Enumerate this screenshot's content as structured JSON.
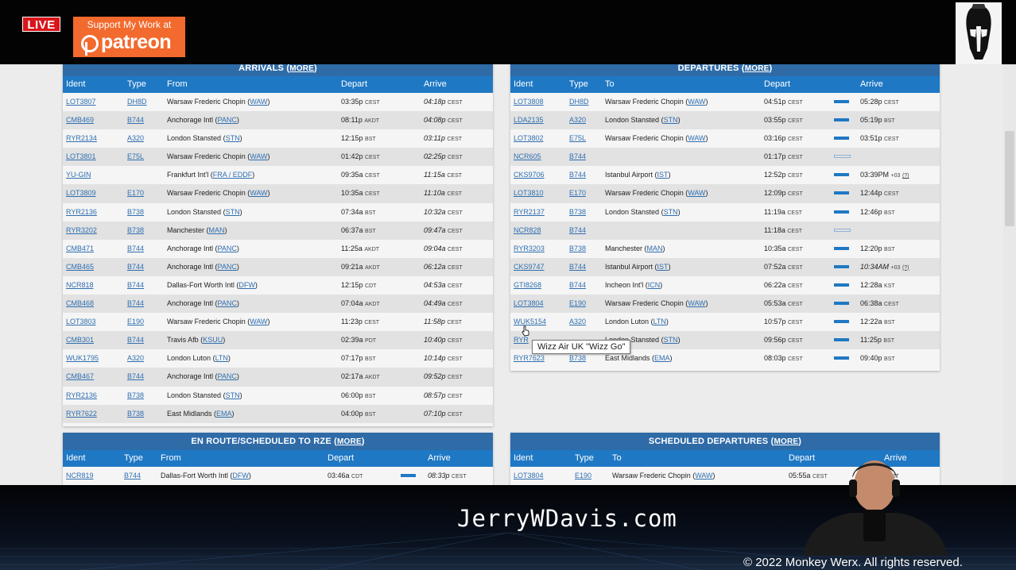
{
  "overlay": {
    "live_label": "LIVE",
    "patreon_support": "Support My Work at",
    "patreon_brand": "patreon",
    "website": "JerryWDavis.com",
    "copyright": "© 2022 Monkey Werx. All rights reserved."
  },
  "tooltip": "Wizz Air UK \"Wizz Go\"",
  "arrivals": {
    "title": "ARRIVALS",
    "more": "MORE",
    "headers": [
      "Ident",
      "Type",
      "From",
      "Depart",
      "Arrive"
    ],
    "rows": [
      {
        "ident": "LOT3807",
        "type": "DH8D",
        "from": "Warsaw Frederic Chopin",
        "code": "WAW",
        "depart": "03:35p",
        "dtz": "CEST",
        "arrive": "04:18p",
        "atz": "CEST"
      },
      {
        "ident": "CMB469",
        "type": "B744",
        "from": "Anchorage Intl",
        "code": "PANC",
        "depart": "08:11p",
        "dtz": "AKDT",
        "arrive": "04:08p",
        "atz": "CEST"
      },
      {
        "ident": "RYR2134",
        "type": "A320",
        "from": "London Stansted",
        "code": "STN",
        "depart": "12:15p",
        "dtz": "BST",
        "arrive": "03:11p",
        "atz": "CEST"
      },
      {
        "ident": "LOT3801",
        "type": "E75L",
        "from": "Warsaw Frederic Chopin",
        "code": "WAW",
        "depart": "01:42p",
        "dtz": "CEST",
        "arrive": "02:25p",
        "atz": "CEST"
      },
      {
        "ident": "YU-GIN",
        "type": "",
        "from": "Frankfurt Int'l",
        "code": "FRA / EDDF",
        "depart": "09:35a",
        "dtz": "CEST",
        "arrive": "11:15a",
        "atz": "CEST"
      },
      {
        "ident": "LOT3809",
        "type": "E170",
        "from": "Warsaw Frederic Chopin",
        "code": "WAW",
        "depart": "10:35a",
        "dtz": "CEST",
        "arrive": "11:10a",
        "atz": "CEST"
      },
      {
        "ident": "RYR2136",
        "type": "B738",
        "from": "London Stansted",
        "code": "STN",
        "depart": "07:34a",
        "dtz": "BST",
        "arrive": "10:32a",
        "atz": "CEST"
      },
      {
        "ident": "RYR3202",
        "type": "B738",
        "from": "Manchester",
        "code": "MAN",
        "depart": "06:37a",
        "dtz": "BST",
        "arrive": "09:47a",
        "atz": "CEST"
      },
      {
        "ident": "CMB471",
        "type": "B744",
        "from": "Anchorage Intl",
        "code": "PANC",
        "depart": "11:25a",
        "dtz": "AKDT",
        "arrive": "09:04a",
        "atz": "CEST"
      },
      {
        "ident": "CMB465",
        "type": "B744",
        "from": "Anchorage Intl",
        "code": "PANC",
        "depart": "09:21a",
        "dtz": "AKDT",
        "arrive": "06:12a",
        "atz": "CEST"
      },
      {
        "ident": "NCR818",
        "type": "B744",
        "from": "Dallas-Fort Worth Intl",
        "code": "DFW",
        "depart": "12:15p",
        "dtz": "CDT",
        "arrive": "04:53a",
        "atz": "CEST"
      },
      {
        "ident": "CMB468",
        "type": "B744",
        "from": "Anchorage Intl",
        "code": "PANC",
        "depart": "07:04a",
        "dtz": "AKDT",
        "arrive": "04:49a",
        "atz": "CEST"
      },
      {
        "ident": "LOT3803",
        "type": "E190",
        "from": "Warsaw Frederic Chopin",
        "code": "WAW",
        "depart": "11:23p",
        "dtz": "CEST",
        "arrive": "11:58p",
        "atz": "CEST"
      },
      {
        "ident": "CMB301",
        "type": "B744",
        "from": "Travis Afb",
        "code": "KSUU",
        "depart": "02:39a",
        "dtz": "PDT",
        "arrive": "10:40p",
        "atz": "CEST"
      },
      {
        "ident": "WUK1795",
        "type": "A320",
        "from": "London Luton",
        "code": "LTN",
        "depart": "07:17p",
        "dtz": "BST",
        "arrive": "10:14p",
        "atz": "CEST"
      },
      {
        "ident": "CMB467",
        "type": "B744",
        "from": "Anchorage Intl",
        "code": "PANC",
        "depart": "02:17a",
        "dtz": "AKDT",
        "arrive": "09:52p",
        "atz": "CEST"
      },
      {
        "ident": "RYR2136",
        "type": "B738",
        "from": "London Stansted",
        "code": "STN",
        "depart": "06:00p",
        "dtz": "BST",
        "arrive": "08:57p",
        "atz": "CEST"
      },
      {
        "ident": "RYR7622",
        "type": "B738",
        "from": "East Midlands",
        "code": "EMA",
        "depart": "04:00p",
        "dtz": "BST",
        "arrive": "07:10p",
        "atz": "CEST"
      }
    ]
  },
  "departures": {
    "title": "DEPARTURES",
    "more": "MORE",
    "headers": [
      "Ident",
      "Type",
      "To",
      "Depart",
      "Arrive"
    ],
    "rows": [
      {
        "ident": "LOT3808",
        "type": "DH8D",
        "to": "Warsaw Frederic Chopin",
        "code": "WAW",
        "depart": "04:51p",
        "dtz": "CEST",
        "progress": 1,
        "arrive": "05:28p",
        "atz": "CEST",
        "arr_italic": false,
        "extra": ""
      },
      {
        "ident": "LDA2135",
        "type": "A320",
        "to": "London Stansted",
        "code": "STN",
        "depart": "03:55p",
        "dtz": "CEST",
        "progress": 1,
        "arrive": "05:19p",
        "atz": "BST",
        "arr_italic": false,
        "extra": ""
      },
      {
        "ident": "LOT3802",
        "type": "E75L",
        "to": "Warsaw Frederic Chopin",
        "code": "WAW",
        "depart": "03:16p",
        "dtz": "CEST",
        "progress": 1,
        "arrive": "03:51p",
        "atz": "CEST",
        "arr_italic": false,
        "extra": ""
      },
      {
        "ident": "NCR605",
        "type": "B744",
        "to": "",
        "code": "",
        "depart": "01:17p",
        "dtz": "CEST",
        "progress": 0,
        "arrive": "",
        "atz": "",
        "arr_italic": false,
        "extra": ""
      },
      {
        "ident": "CKS9706",
        "type": "B744",
        "to": "Istanbul Airport",
        "code": "IST",
        "depart": "12:52p",
        "dtz": "CEST",
        "progress": 1,
        "arrive": "03:39PM",
        "atz": "+03",
        "arr_italic": false,
        "extra": "(?)"
      },
      {
        "ident": "LOT3810",
        "type": "E170",
        "to": "Warsaw Frederic Chopin",
        "code": "WAW",
        "depart": "12:09p",
        "dtz": "CEST",
        "progress": 1,
        "arrive": "12:44p",
        "atz": "CEST",
        "arr_italic": false,
        "extra": ""
      },
      {
        "ident": "RYR2137",
        "type": "B738",
        "to": "London Stansted",
        "code": "STN",
        "depart": "11:19a",
        "dtz": "CEST",
        "progress": 1,
        "arrive": "12:46p",
        "atz": "BST",
        "arr_italic": false,
        "extra": ""
      },
      {
        "ident": "NCR828",
        "type": "B744",
        "to": "",
        "code": "",
        "depart": "11:18a",
        "dtz": "CEST",
        "progress": 0,
        "arrive": "",
        "atz": "",
        "arr_italic": false,
        "extra": ""
      },
      {
        "ident": "RYR3203",
        "type": "B738",
        "to": "Manchester",
        "code": "MAN",
        "depart": "10:35a",
        "dtz": "CEST",
        "progress": 1,
        "arrive": "12:20p",
        "atz": "BST",
        "arr_italic": false,
        "extra": ""
      },
      {
        "ident": "CKS9747",
        "type": "B744",
        "to": "Istanbul Airport",
        "code": "IST",
        "depart": "07:52a",
        "dtz": "CEST",
        "progress": 1,
        "arrive": "10:34AM",
        "atz": "+03",
        "arr_italic": true,
        "extra": "(?)"
      },
      {
        "ident": "GTI8268",
        "type": "B744",
        "to": "Incheon Int'l",
        "code": "ICN",
        "depart": "06:22a",
        "dtz": "CEST",
        "progress": 1,
        "arrive": "12:28a",
        "atz": "KST",
        "arr_italic": false,
        "extra": ""
      },
      {
        "ident": "LOT3804",
        "type": "E190",
        "to": "Warsaw Frederic Chopin",
        "code": "WAW",
        "depart": "05:53a",
        "dtz": "CEST",
        "progress": 1,
        "arrive": "06:38a",
        "atz": "CEST",
        "arr_italic": false,
        "extra": ""
      },
      {
        "ident": "WUK5154",
        "type": "A320",
        "to": "London Luton",
        "code": "LTN",
        "depart": "10:57p",
        "dtz": "CEST",
        "progress": 1,
        "arrive": "12:22a",
        "atz": "BST",
        "arr_italic": false,
        "extra": ""
      },
      {
        "ident": "RYR",
        "type": "",
        "to": "London Stansted",
        "code": "STN",
        "depart": "09:56p",
        "dtz": "CEST",
        "progress": 1,
        "arrive": "11:25p",
        "atz": "BST",
        "arr_italic": false,
        "extra": ""
      },
      {
        "ident": "RYR7623",
        "type": "B738",
        "to": "East Midlands",
        "code": "EMA",
        "depart": "08:03p",
        "dtz": "CEST",
        "progress": 1,
        "arrive": "09:40p",
        "atz": "BST",
        "arr_italic": false,
        "extra": ""
      }
    ]
  },
  "enroute": {
    "title": "EN ROUTE/SCHEDULED TO RZE",
    "more": "MORE",
    "headers": [
      "Ident",
      "Type",
      "From",
      "Depart",
      "Arrive"
    ],
    "rows": [
      {
        "ident": "NCR819",
        "type": "B744",
        "from": "Dallas-Fort Worth Intl",
        "code": "DFW",
        "depart": "03:46a",
        "dtz": "CDT",
        "arrive": "08:33p",
        "atz": "CEST"
      }
    ]
  },
  "scheduled": {
    "title": "SCHEDULED DEPARTURES",
    "more": "MORE",
    "headers": [
      "Ident",
      "Type",
      "To",
      "Depart",
      "Arrive"
    ],
    "rows": [
      {
        "ident": "LOT3804",
        "type": "E190",
        "to": "Warsaw Frederic Chopin",
        "code": "WAW",
        "depart": "05:55a",
        "dtz": "CEST",
        "arrive": "",
        "atz": "CEST"
      }
    ]
  }
}
